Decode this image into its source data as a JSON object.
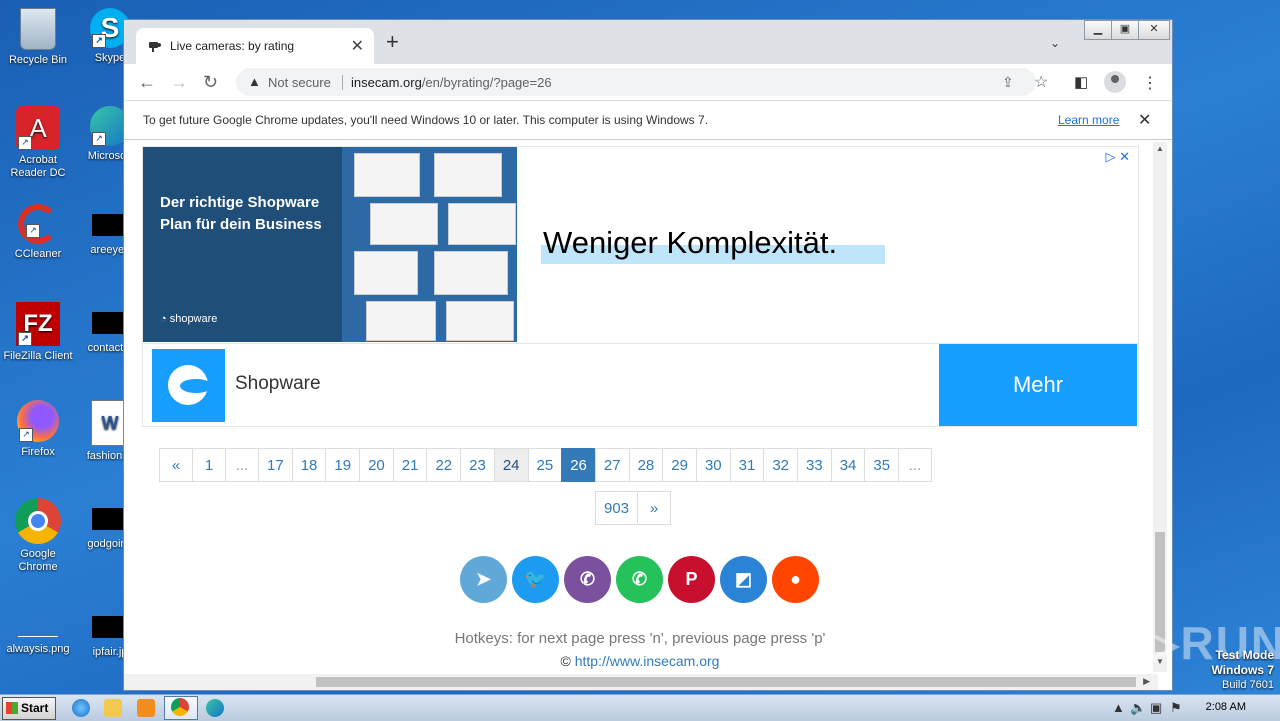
{
  "desktop": {
    "icons": [
      {
        "label": "Recycle Bin"
      },
      {
        "label": "Skype"
      },
      {
        "label": "Acrobat Reader DC"
      },
      {
        "label": "Microsoft"
      },
      {
        "label": "CCleaner"
      },
      {
        "label": "areeyes"
      },
      {
        "label": "FileZilla Client"
      },
      {
        "label": "contactfri"
      },
      {
        "label": "Firefox"
      },
      {
        "label": "fashionsy"
      },
      {
        "label": "Google Chrome"
      },
      {
        "label": "godgoing"
      },
      {
        "label": "alwaysis.png"
      },
      {
        "label": "ipfair.jp"
      }
    ]
  },
  "browser": {
    "tab_title": "Live cameras: by rating",
    "tab_close": "✕",
    "new_tab": "+",
    "tab_menu": "⌄",
    "window_controls": {
      "minimize": "▁",
      "maximize": "▣",
      "close": "✕"
    },
    "not_secure_label": "Not secure",
    "url_host": "insecam.org",
    "url_path": "/en/byrating/?page=26",
    "infobar_message": "To get future Google Chrome updates, you'll need Windows 10 or later. This computer is using Windows 7.",
    "infobar_link": "Learn more"
  },
  "ad": {
    "left_headline": "Der richtige Shopware Plan für dein Business",
    "left_brand": "shopware",
    "headline": "Weniger Komplexität.",
    "advertiser": "Shopware",
    "cta": "Mehr",
    "badge": "▷ ✕",
    "brand_color": "#189eff"
  },
  "pagination": {
    "row1": [
      {
        "label": "«",
        "state": "normal"
      },
      {
        "label": "1",
        "state": "normal"
      },
      {
        "label": "...",
        "state": "dim"
      },
      {
        "label": "17",
        "state": "normal"
      },
      {
        "label": "18",
        "state": "normal"
      },
      {
        "label": "19",
        "state": "normal"
      },
      {
        "label": "20",
        "state": "normal"
      },
      {
        "label": "21",
        "state": "normal"
      },
      {
        "label": "22",
        "state": "normal"
      },
      {
        "label": "23",
        "state": "normal"
      },
      {
        "label": "24",
        "state": "gray"
      },
      {
        "label": "25",
        "state": "normal"
      },
      {
        "label": "26",
        "state": "active"
      },
      {
        "label": "27",
        "state": "normal"
      },
      {
        "label": "28",
        "state": "normal"
      },
      {
        "label": "29",
        "state": "normal"
      },
      {
        "label": "30",
        "state": "normal"
      },
      {
        "label": "31",
        "state": "normal"
      },
      {
        "label": "32",
        "state": "normal"
      },
      {
        "label": "33",
        "state": "normal"
      },
      {
        "label": "34",
        "state": "normal"
      },
      {
        "label": "35",
        "state": "normal"
      },
      {
        "label": "...",
        "state": "dim"
      }
    ],
    "row2": [
      {
        "label": "903",
        "state": "normal"
      },
      {
        "label": "»",
        "state": "normal"
      }
    ]
  },
  "social": [
    {
      "name": "telegram-icon",
      "glyph": "➤",
      "color": "#5fa8d8"
    },
    {
      "name": "twitter-icon",
      "glyph": "🐦",
      "color": "#1d9bf0"
    },
    {
      "name": "viber-icon",
      "glyph": "✆",
      "color": "#7b519d"
    },
    {
      "name": "whatsapp-icon",
      "glyph": "✆",
      "color": "#25c15a"
    },
    {
      "name": "pinterest-icon",
      "glyph": "P",
      "color": "#c8102e"
    },
    {
      "name": "delicious-icon",
      "glyph": "◩",
      "color": "#2a83d6"
    },
    {
      "name": "reddit-icon",
      "glyph": "●",
      "color": "#ff4500"
    }
  ],
  "footer": {
    "hotkeys": "Hotkeys: for next page press 'n', previous page press 'p'",
    "copyright_symbol": "©",
    "copyright_link": "http://www.insecam.org"
  },
  "watermark": {
    "text": "ANY▷RUN",
    "test_mode": "Test Mode",
    "os": "Windows 7",
    "build": "Build 7601"
  },
  "taskbar": {
    "start_label": "Start",
    "clock": "2:08 AM"
  }
}
